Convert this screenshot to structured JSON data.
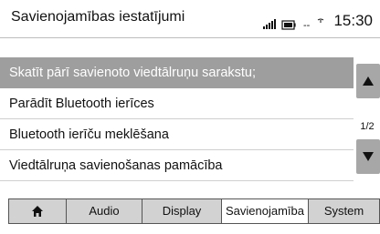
{
  "header": {
    "title": "Savienojamības iestatījumi",
    "time": "15:30",
    "signal_icon": "signal-bars-icon",
    "battery_icon": "battery-icon",
    "wifi_text": "--"
  },
  "menu": {
    "items": [
      {
        "label": "Skatīt pārī savienoto viedtālruņu sarakstu;",
        "selected": true
      },
      {
        "label": "Parādīt Bluetooth ierīces",
        "selected": false
      },
      {
        "label": "Bluetooth ierīču meklēšana",
        "selected": false
      },
      {
        "label": "Viedtālruņa savienošanas pamācība",
        "selected": false
      }
    ],
    "page_indicator": "1/2",
    "scroll_up_icon": "triangle-up-icon",
    "scroll_down_icon": "triangle-down-icon"
  },
  "tabs": [
    {
      "label": "",
      "icon": "home-icon",
      "active": false
    },
    {
      "label": "Audio",
      "active": false
    },
    {
      "label": "Display",
      "active": false
    },
    {
      "label": "Savienojamība",
      "active": true
    },
    {
      "label": "System",
      "active": false
    }
  ],
  "colors": {
    "selected_row": "#9e9e9e",
    "scroll_button": "#a7a7a7",
    "tab_background": "#d2d2d2",
    "active_tab": "#ffffff"
  }
}
